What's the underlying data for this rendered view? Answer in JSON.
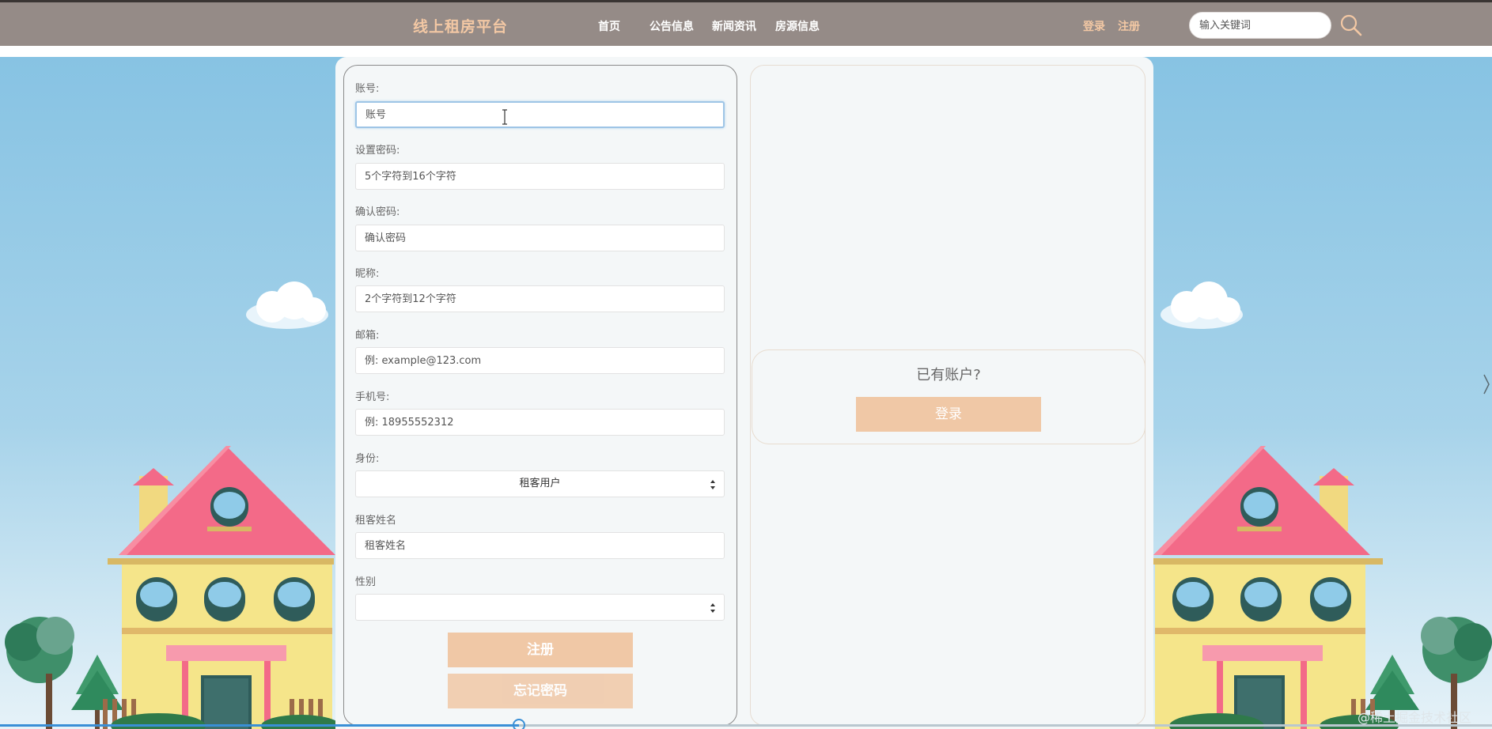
{
  "header": {
    "brand": "线上租房平台",
    "nav": [
      "首页",
      "公告信息",
      "新闻资讯",
      "房源信息"
    ],
    "login": "登录",
    "register": "注册",
    "search_placeholder": "输入关键词",
    "search_icon": "search-icon"
  },
  "form": {
    "account_label": "账号:",
    "account_placeholder": "账号",
    "password_label": "设置密码:",
    "password_placeholder": "5个字符到16个字符",
    "confirm_label": "确认密码:",
    "confirm_placeholder": "确认密码",
    "nickname_label": "昵称:",
    "nickname_placeholder": "2个字符到12个字符",
    "email_label": "邮箱:",
    "email_placeholder": "例: example@123.com",
    "phone_label": "手机号:",
    "phone_placeholder": "例: 18955552312",
    "role_label": "身份:",
    "role_value": "租客用户",
    "tenant_name_label": "租客姓名",
    "tenant_name_placeholder": "租客姓名",
    "gender_label": "性别",
    "gender_value": "",
    "register_button": "注册",
    "forgot_button": "忘记密码"
  },
  "side": {
    "have_account": "已有账户?",
    "login_button": "登录"
  },
  "video": {
    "progress": 0.35
  },
  "watermark": "@稀土掘金技术社区",
  "colors": {
    "topbar": "#958b87",
    "accent": "#f0c8a6",
    "sky": "#87c3e3"
  }
}
